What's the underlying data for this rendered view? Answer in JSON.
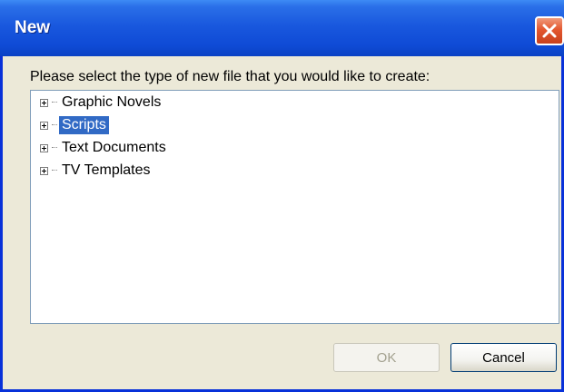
{
  "window": {
    "title": "New",
    "close_icon": "close-icon"
  },
  "prompt_text": "Please select the type of new file that you would like to create:",
  "tree": {
    "items": [
      {
        "label": "Graphic Novels",
        "expanded": false,
        "selected": false
      },
      {
        "label": "Scripts",
        "expanded": false,
        "selected": true
      },
      {
        "label": "Text Documents",
        "expanded": false,
        "selected": false
      },
      {
        "label": "TV Templates",
        "expanded": false,
        "selected": false
      }
    ]
  },
  "buttons": {
    "ok_label": "OK",
    "ok_enabled": false,
    "cancel_label": "Cancel"
  },
  "colors": {
    "titlebar": "#0f4bd6",
    "selection": "#316ac5",
    "dialog_bg": "#ece9d8",
    "close_button": "#e3572f"
  }
}
